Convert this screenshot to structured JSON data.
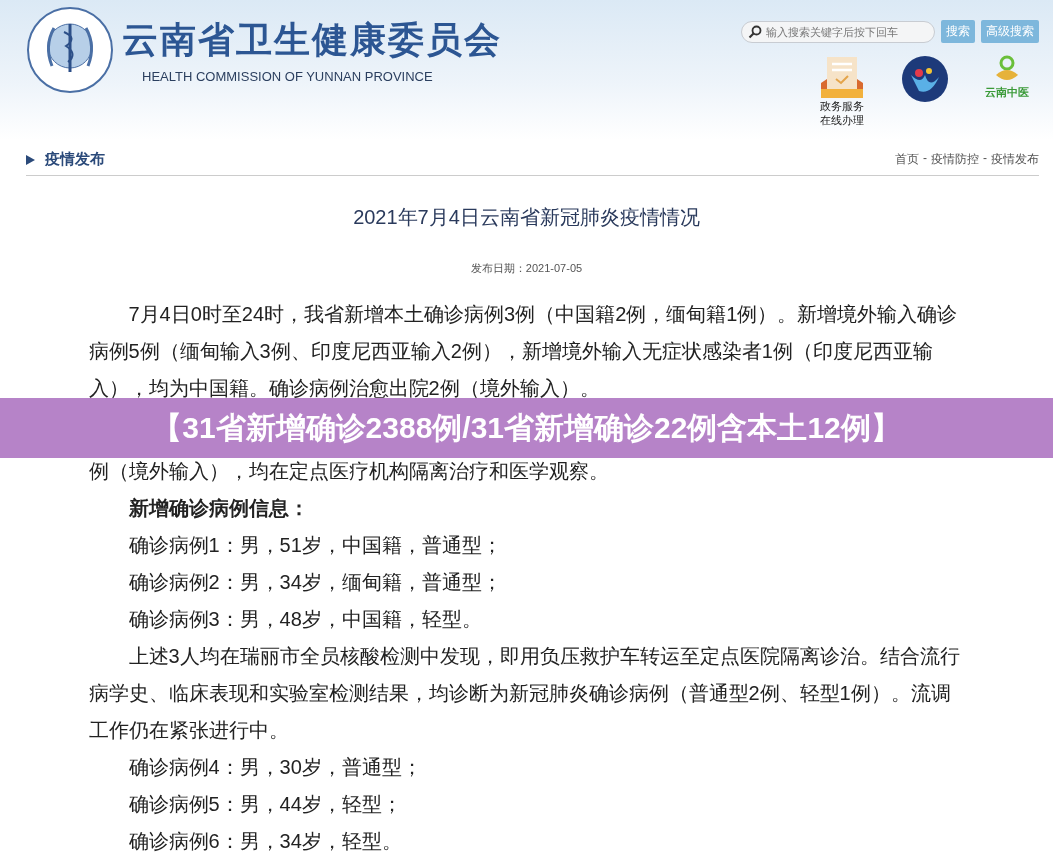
{
  "header": {
    "title": "云南省卫生健康委员会",
    "subtitle": "HEALTH COMMISSION OF YUNNAN PROVINCE",
    "search": {
      "placeholder": "输入搜索关键字后按下回车"
    },
    "buttons": [
      "搜索",
      "高级搜索"
    ],
    "service_link": [
      "政务服务",
      "在线办理"
    ],
    "tcm_logo": "云南中医"
  },
  "section": {
    "title": "疫情发布",
    "breadcrumb": [
      "首页",
      "疫情防控",
      "疫情发布"
    ],
    "separator": "-"
  },
  "article": {
    "title": "2021年7月4日云南省新冠肺炎疫情情况",
    "date_label": "发布日期：",
    "date": "2021-07-05",
    "blocks": [
      {
        "kind": "para",
        "text": "7月4日0时至24时，我省新增本土确诊病例3例（中国籍2例，缅甸籍1例）。新增境外输入确诊病例5例（缅甸输入3例、印度尼西亚输入2例），新增境外输入无症状感染者1例（印度尼西亚输入），均为中国籍。确诊病例治愈出院2例（境外输入）。"
      },
      {
        "kind": "hidden"
      },
      {
        "kind": "line",
        "text": "例（境外输入），均在定点医疗机构隔离治疗和医学观察。"
      },
      {
        "kind": "heading",
        "text": "新增确诊病例信息："
      },
      {
        "kind": "para",
        "text": "确诊病例1：男，51岁，中国籍，普通型；"
      },
      {
        "kind": "para",
        "text": "确诊病例2：男，34岁，缅甸籍，普通型；"
      },
      {
        "kind": "para",
        "text": "确诊病例3：男，48岁，中国籍，轻型。"
      },
      {
        "kind": "para",
        "text": "上述3人均在瑞丽市全员核酸检测中发现，即用负压救护车转运至定点医院隔离诊治。结合流行病学史、临床表现和实验室检测结果，均诊断为新冠肺炎确诊病例（普通型2例、轻型1例）。流调工作仍在紧张进行中。"
      },
      {
        "kind": "para",
        "text": "确诊病例4：男，30岁，普通型；"
      },
      {
        "kind": "para",
        "text": "确诊病例5：男，44岁，轻型；"
      },
      {
        "kind": "para",
        "text": "确诊病例6：男，34岁，轻型。"
      }
    ]
  },
  "banner": {
    "text": "【31省新增确诊2388例/31省新增确诊22例含本土12例】"
  }
}
